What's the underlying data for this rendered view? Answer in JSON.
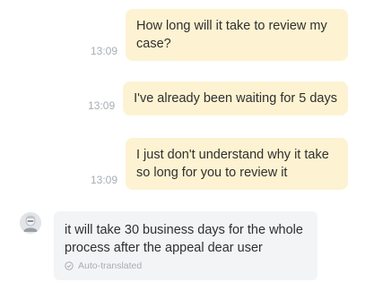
{
  "messages_out": [
    {
      "time": "13:09",
      "text": "How long will it take to review my case?"
    },
    {
      "time": "13:09",
      "text": "I've already been waiting for 5 days"
    },
    {
      "time": "13:09",
      "text": "I just don't understand why it take so long for you to review it"
    }
  ],
  "message_in": {
    "text": "it will take 30 business days for the whole process after the appeal dear user",
    "translation_note": "Auto-translated",
    "icon": "check-circle-icon"
  },
  "colors": {
    "outgoing_bubble": "#fdf3d2",
    "incoming_bubble": "#f3f4f6",
    "timestamp": "#a8adb5",
    "text": "#2f2f2f"
  }
}
